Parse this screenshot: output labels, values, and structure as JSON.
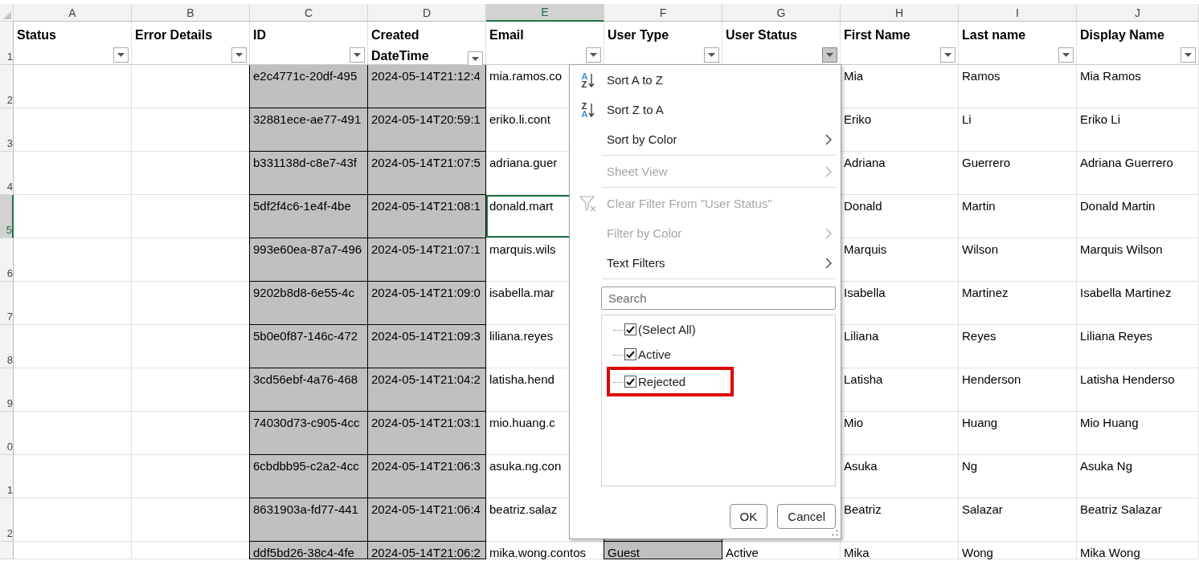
{
  "header_row": {
    "number": "1"
  },
  "columns": [
    {
      "letter": "A",
      "header": "Status",
      "selected": false,
      "shaded": false,
      "filter_open": false
    },
    {
      "letter": "B",
      "header": "Error Details",
      "selected": false,
      "shaded": false,
      "filter_open": false
    },
    {
      "letter": "C",
      "header": "ID",
      "selected": false,
      "shaded": true,
      "filter_open": false
    },
    {
      "letter": "D",
      "header": "Created DateTime",
      "selected": false,
      "shaded": true,
      "filter_open": false
    },
    {
      "letter": "E",
      "header": "Email",
      "selected": true,
      "shaded": false,
      "filter_open": false
    },
    {
      "letter": "F",
      "header": "User Type",
      "selected": false,
      "shaded": true,
      "filter_open": false
    },
    {
      "letter": "G",
      "header": "User Status",
      "selected": false,
      "shaded": false,
      "filter_open": true
    },
    {
      "letter": "H",
      "header": "First Name",
      "selected": false,
      "shaded": false,
      "filter_open": false
    },
    {
      "letter": "I",
      "header": "Last name",
      "selected": false,
      "shaded": false,
      "filter_open": false
    },
    {
      "letter": "J",
      "header": "Display Name",
      "selected": false,
      "shaded": false,
      "filter_open": false
    }
  ],
  "rows": [
    {
      "number": "2",
      "selected": false,
      "cells": {
        "C": "e2c4771c-20df-495",
        "D": "2024-05-14T21:12:4",
        "E": "mia.ramos.co",
        "H": "Mia",
        "I": "Ramos",
        "J": "Mia Ramos"
      }
    },
    {
      "number": "3",
      "selected": false,
      "cells": {
        "C": "32881ece-ae77-491",
        "D": "2024-05-14T20:59:1",
        "E": "eriko.li.cont",
        "H": "Eriko",
        "I": "Li",
        "J": "Eriko Li"
      }
    },
    {
      "number": "4",
      "selected": false,
      "cells": {
        "C": "b331138d-c8e7-43f",
        "D": "2024-05-14T21:07:5",
        "E": "adriana.guer",
        "H": "Adriana",
        "I": "Guerrero",
        "J": "Adriana Guerrero"
      }
    },
    {
      "number": "5",
      "selected": true,
      "cells": {
        "C": "5df2f4c6-1e4f-4be",
        "D": "2024-05-14T21:08:1",
        "E": "donald.mart",
        "H": "Donald",
        "I": "Martin",
        "J": "Donald Martin"
      }
    },
    {
      "number": "6",
      "selected": false,
      "cells": {
        "C": "993e60ea-87a7-496",
        "D": "2024-05-14T21:07:1",
        "E": "marquis.wils",
        "H": "Marquis",
        "I": "Wilson",
        "J": "Marquis Wilson"
      }
    },
    {
      "number": "7",
      "selected": false,
      "cells": {
        "C": "9202b8d8-6e55-4c",
        "D": "2024-05-14T21:09:0",
        "E": "isabella.mar",
        "H": "Isabella",
        "I": "Martinez",
        "J": "Isabella Martinez"
      }
    },
    {
      "number": "8",
      "selected": false,
      "cells": {
        "C": "5b0e0f87-146c-472",
        "D": "2024-05-14T21:09:3",
        "E": "liliana.reyes",
        "H": "Liliana",
        "I": "Reyes",
        "J": "Liliana Reyes"
      }
    },
    {
      "number": "9",
      "selected": false,
      "cells": {
        "C": "3cd56ebf-4a76-468",
        "D": "2024-05-14T21:04:2",
        "E": "latisha.hend",
        "H": "Latisha",
        "I": "Henderson",
        "J": "Latisha Henderso"
      }
    },
    {
      "number": "0",
      "selected": false,
      "cells": {
        "C": "74030d73-c905-4cc",
        "D": "2024-05-14T21:03:1",
        "E": "mio.huang.c",
        "H": "Mio",
        "I": "Huang",
        "J": "Mio Huang"
      }
    },
    {
      "number": "1",
      "selected": false,
      "cells": {
        "C": "6cbdbb95-c2a2-4cc",
        "D": "2024-05-14T21:06:3",
        "E": "asuka.ng.con",
        "H": "Asuka",
        "I": "Ng",
        "J": "Asuka Ng"
      }
    },
    {
      "number": "2",
      "selected": false,
      "cells": {
        "C": "8631903a-fd77-441",
        "D": "2024-05-14T21:06:4",
        "E": "beatriz.salaz",
        "H": "Beatriz",
        "I": "Salazar",
        "J": "Beatriz Salazar"
      }
    },
    {
      "selected": false,
      "cells": {
        "C": "ddf5bd26-38c4-4fe",
        "D": "2024-05-14T21:06:2",
        "E": "mika.wong.contos",
        "F": "Guest",
        "G": "Active",
        "H": "Mika",
        "I": "Wong",
        "J": "Mika Wong"
      }
    }
  ],
  "filter_menu": {
    "items": [
      {
        "kind": "sort",
        "label": "Sort A to Z",
        "disabled": false,
        "icon_letters": [
          {
            "char": "A",
            "accent": true
          },
          {
            "char": "Z",
            "accent": false
          }
        ]
      },
      {
        "kind": "sort",
        "label": "Sort Z to A",
        "disabled": false,
        "icon_letters": [
          {
            "char": "Z",
            "accent": false
          },
          {
            "char": "A",
            "accent": true
          }
        ]
      },
      {
        "kind": "submenu",
        "label": "Sort by Color",
        "disabled": false
      },
      {
        "kind": "separator"
      },
      {
        "kind": "submenu",
        "label": "Sheet View",
        "disabled": true
      },
      {
        "kind": "separator"
      },
      {
        "kind": "clear_filter",
        "label": "Clear Filter From \"User Status\"",
        "disabled": true
      },
      {
        "kind": "submenu",
        "label": "Filter by Color",
        "disabled": true
      },
      {
        "kind": "submenu",
        "label": "Text Filters",
        "disabled": false
      },
      {
        "kind": "separator"
      }
    ],
    "search": {
      "placeholder": "Search"
    },
    "values": [
      {
        "label": "(Select All)",
        "checked": true,
        "highlighted": false
      },
      {
        "label": "Active",
        "checked": true,
        "highlighted": false
      },
      {
        "label": "Rejected",
        "checked": true,
        "highlighted": true
      }
    ],
    "buttons": [
      "OK",
      "Cancel"
    ]
  }
}
